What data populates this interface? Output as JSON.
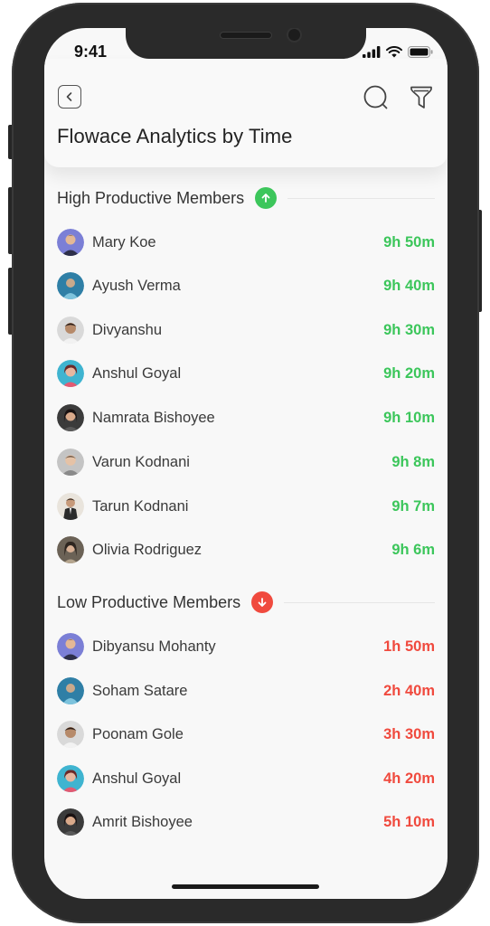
{
  "status_bar": {
    "time": "9:41"
  },
  "header": {
    "title": "Flowace Analytics by Time"
  },
  "colors": {
    "good": "#3cc65b",
    "bad": "#f04a3e"
  },
  "high_section": {
    "title": "High Productive Members",
    "members": [
      {
        "name": "Mary Koe",
        "time": "9h 50m"
      },
      {
        "name": "Ayush Verma",
        "time": "9h 40m"
      },
      {
        "name": "Divyanshu",
        "time": "9h 30m"
      },
      {
        "name": "Anshul Goyal",
        "time": "9h 20m"
      },
      {
        "name": "Namrata Bishoyee",
        "time": "9h 10m"
      },
      {
        "name": "Varun Kodnani",
        "time": "9h 8m"
      },
      {
        "name": "Tarun Kodnani",
        "time": "9h 7m"
      },
      {
        "name": "Olivia Rodriguez",
        "time": "9h 6m"
      }
    ]
  },
  "low_section": {
    "title": "Low Productive Members",
    "members": [
      {
        "name": "Dibyansu Mohanty",
        "time": "1h 50m"
      },
      {
        "name": "Soham Satare",
        "time": "2h 40m"
      },
      {
        "name": "Poonam Gole",
        "time": "3h 30m"
      },
      {
        "name": "Anshul Goyal",
        "time": "4h 20m"
      },
      {
        "name": "Amrit Bishoyee",
        "time": "5h 10m"
      }
    ]
  }
}
